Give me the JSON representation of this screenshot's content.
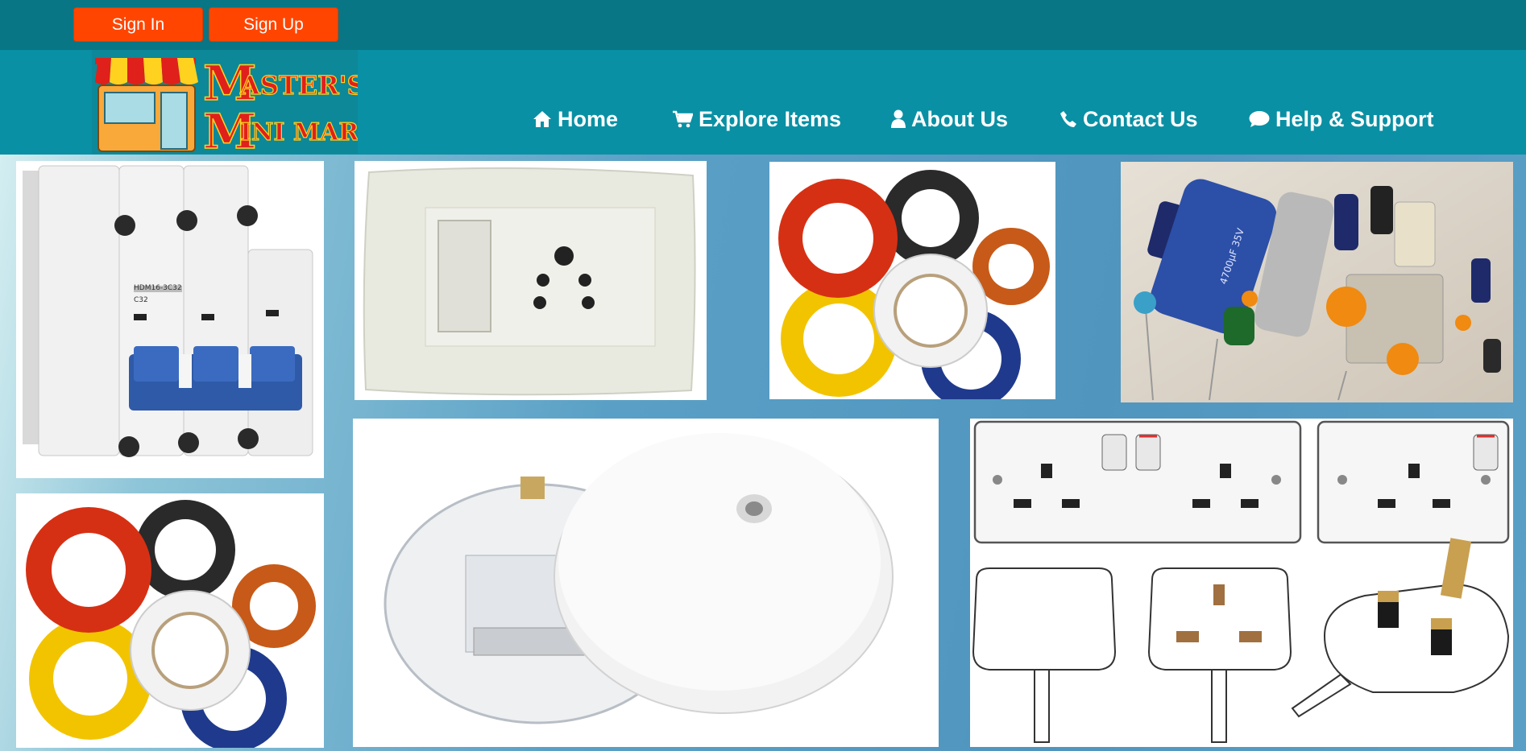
{
  "auth": {
    "signin_label": "Sign In",
    "signup_label": "Sign Up"
  },
  "brand": {
    "logo_line1_initial": "M",
    "logo_line1_rest": "ASTER'S",
    "logo_line2_initial": "M",
    "logo_line2_rest": "INI MART"
  },
  "nav": {
    "items": [
      {
        "label": "Home",
        "icon": "home-icon"
      },
      {
        "label": "Explore Items",
        "icon": "cart-icon"
      },
      {
        "label": "About Us",
        "icon": "user-icon"
      },
      {
        "label": "Contact Us",
        "icon": "phone-icon"
      },
      {
        "label": "Help & Support",
        "icon": "chat-icon"
      }
    ]
  },
  "gallery": {
    "breaker_labels": [
      "HDM16-3C32",
      "C32"
    ],
    "capacitor_label": "4700µF 35V"
  },
  "colors": {
    "topbar": "#087684",
    "navbar": "#0a90a4",
    "auth_button": "#ff4500",
    "logo_text": "#e0201b"
  }
}
